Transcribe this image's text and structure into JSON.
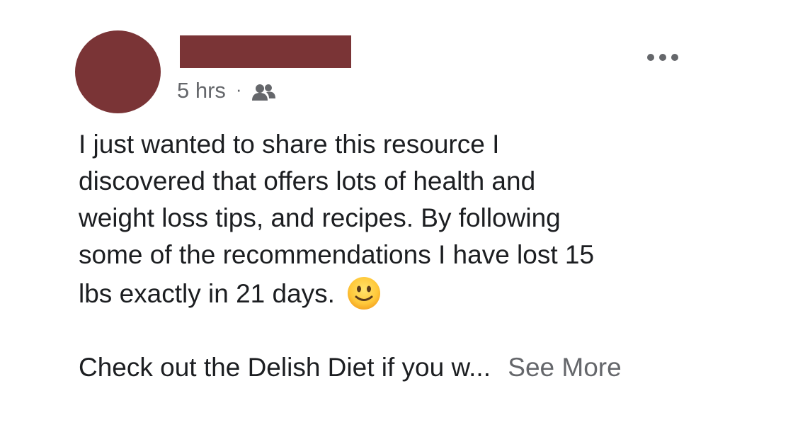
{
  "post": {
    "timestamp": "5 hrs",
    "separator": "·",
    "audience_icon": "friends-icon",
    "more_icon": "more-options-icon",
    "body_lines": [
      "I just wanted to share this resource I",
      "discovered that offers lots of health and",
      "weight loss tips, and recipes. By following",
      "some of the recommendations I have lost 15",
      "lbs exactly in 21 days."
    ],
    "emoji": "slightly-smiling-face-emoji",
    "truncated_text": "Check out the Delish Diet if you w...",
    "see_more_label": "See More"
  },
  "colors": {
    "redaction": "#7a3436",
    "text": "#1c1e21",
    "secondary_text": "#65676b"
  }
}
